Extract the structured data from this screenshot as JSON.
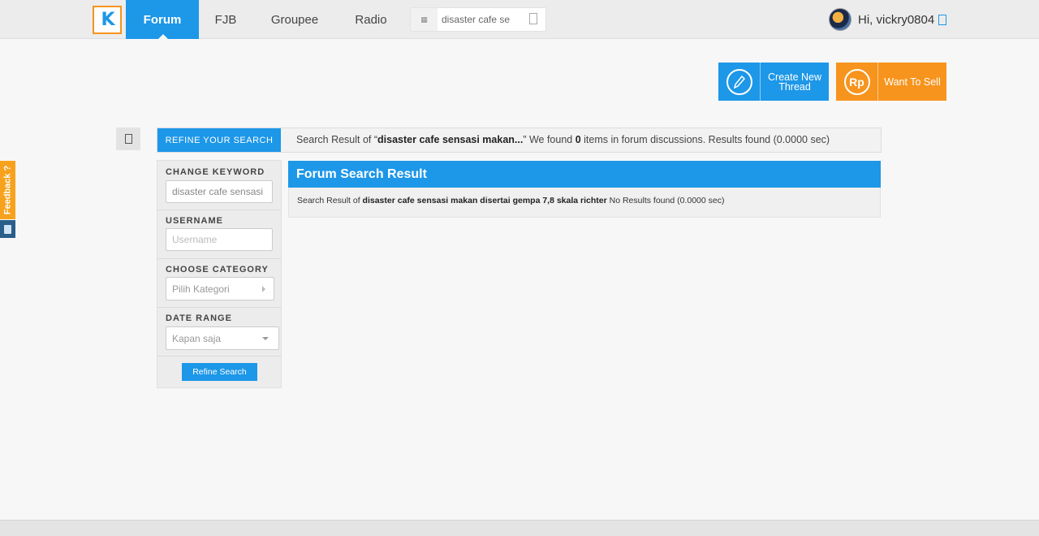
{
  "nav": {
    "logo_text": "K",
    "items": [
      {
        "label": "Forum",
        "active": true
      },
      {
        "label": "FJB"
      },
      {
        "label": "Groupee"
      },
      {
        "label": "Radio"
      }
    ],
    "search_value": "disaster cafe se",
    "greeting": "Hi, vickry0804"
  },
  "actions": {
    "create_thread": "Create New Thread",
    "want_to_sell": "Want To Sell",
    "sell_icon_text": "Rp"
  },
  "feedback_label": "Feedback ?",
  "refine": {
    "tab_label": "REFINE YOUR SEARCH",
    "summary_prefix": "Search Result of “",
    "summary_keyword": "disaster cafe sensasi makan...",
    "summary_mid": "” We found ",
    "summary_count": "0",
    "summary_suffix": " items in forum discussions. Results found (0.0000 sec)"
  },
  "sidebar": {
    "keyword_label": "CHANGE KEYWORD",
    "keyword_value": "disaster cafe sensasi",
    "username_label": "USERNAME",
    "username_placeholder": "Username",
    "category_label": "CHOOSE CATEGORY",
    "category_value": "Pilih Kategori",
    "date_label": "DATE RANGE",
    "date_value": "Kapan saja",
    "refine_button": "Refine Search"
  },
  "results": {
    "title": "Forum Search Result",
    "body_prefix": "Search Result of ",
    "body_keyword": "disaster cafe sensasi makan disertai gempa 7,8 skala richter",
    "body_suffix": " No Results found (0.0000 sec)"
  },
  "colors": {
    "accent_blue": "#1d97e8",
    "accent_orange": "#f7941d"
  }
}
